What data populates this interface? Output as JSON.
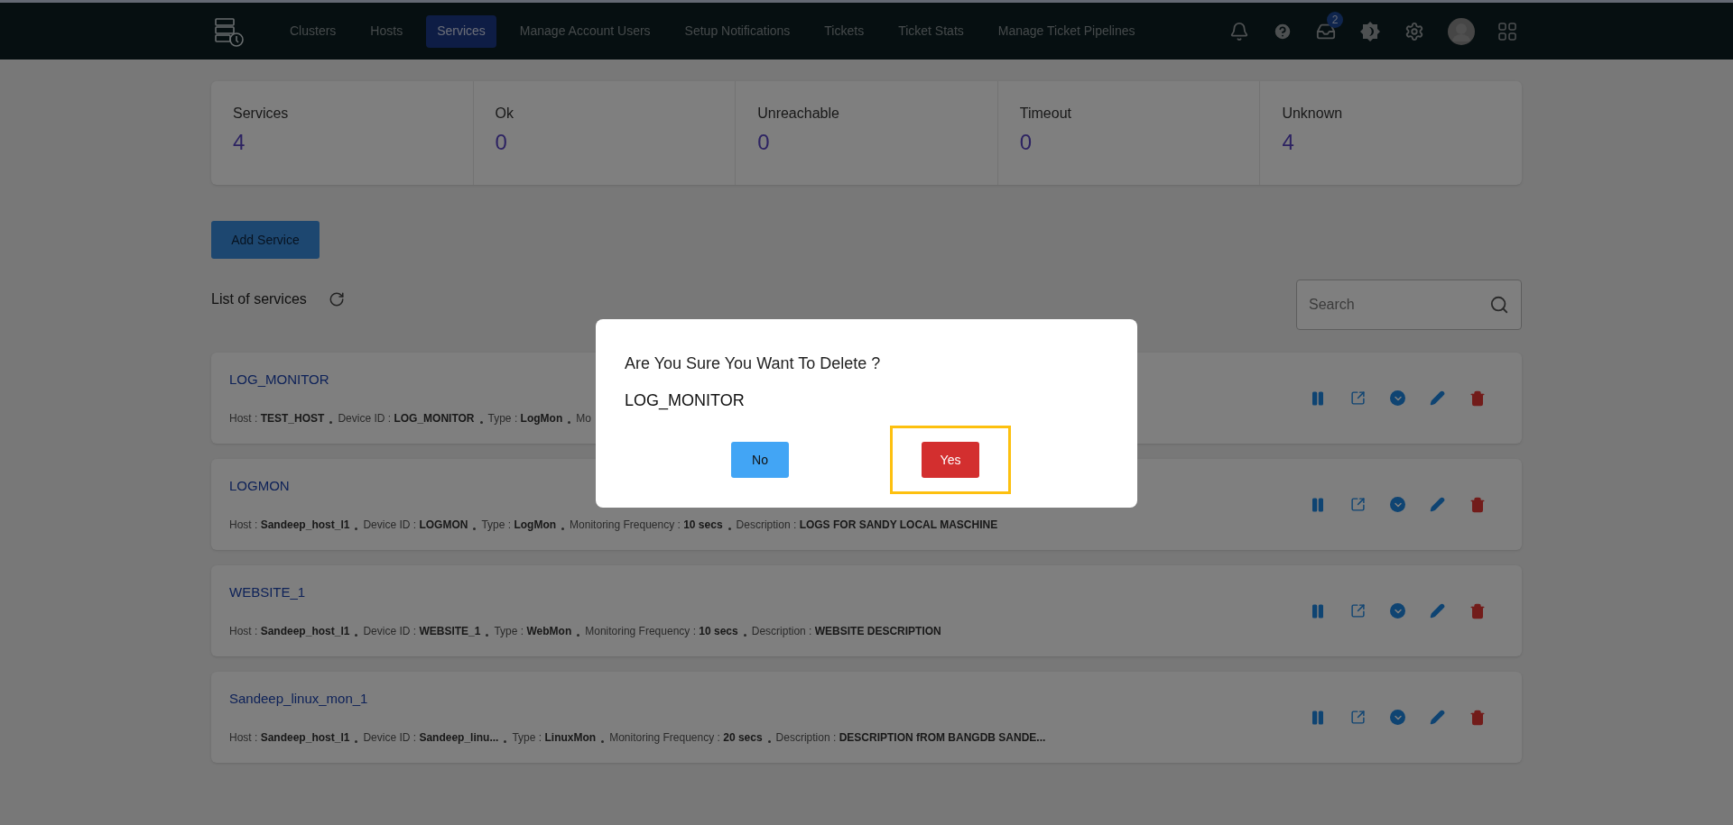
{
  "navbar": {
    "items": [
      {
        "label": "Clusters",
        "selected": false
      },
      {
        "label": "Hosts",
        "selected": false
      },
      {
        "label": "Services",
        "selected": true
      },
      {
        "label": "Manage Account Users",
        "selected": false
      },
      {
        "label": "Setup Notifications",
        "selected": false
      },
      {
        "label": "Tickets",
        "selected": false
      },
      {
        "label": "Ticket Stats",
        "selected": false
      },
      {
        "label": "Manage Ticket Pipelines",
        "selected": false
      }
    ],
    "inbox_badge": "2"
  },
  "stats": [
    {
      "label": "Services",
      "value": "4"
    },
    {
      "label": "Ok",
      "value": "0"
    },
    {
      "label": "Unreachable",
      "value": "0"
    },
    {
      "label": "Timeout",
      "value": "0"
    },
    {
      "label": "Unknown",
      "value": "4"
    }
  ],
  "add_button": "Add Service",
  "list_title": "List of services",
  "search": {
    "placeholder": "Search"
  },
  "services": [
    {
      "name": "LOG_MONITOR",
      "fields": [
        {
          "label": "Host :",
          "value": "TEST_HOST"
        },
        {
          "label": "Device ID :",
          "value": "LOG_MONITOR"
        },
        {
          "label": "Type :",
          "value": "LogMon"
        },
        {
          "label": "Mo"
        }
      ]
    },
    {
      "name": "LOGMON",
      "fields": [
        {
          "label": "Host :",
          "value": "Sandeep_host_l1"
        },
        {
          "label": "Device ID :",
          "value": "LOGMON"
        },
        {
          "label": "Type :",
          "value": "LogMon"
        },
        {
          "label": "Monitoring Frequency :",
          "value": "10 secs"
        },
        {
          "label": "Description :",
          "value": "LOGS FOR SANDY LOCAL MASCHINE"
        }
      ]
    },
    {
      "name": "WEBSITE_1",
      "fields": [
        {
          "label": "Host :",
          "value": "Sandeep_host_l1"
        },
        {
          "label": "Device ID :",
          "value": "WEBSITE_1"
        },
        {
          "label": "Type :",
          "value": "WebMon"
        },
        {
          "label": "Monitoring Frequency :",
          "value": "10 secs"
        },
        {
          "label": "Description :",
          "value": "WEBSITE DESCRIPTION"
        }
      ]
    },
    {
      "name": "Sandeep_linux_mon_1",
      "fields": [
        {
          "label": "Host :",
          "value": "Sandeep_host_l1"
        },
        {
          "label": "Device ID :",
          "value": "Sandeep_linu..."
        },
        {
          "label": "Type :",
          "value": "LinuxMon"
        },
        {
          "label": "Monitoring Frequency :",
          "value": "20 secs"
        },
        {
          "label": "Description :",
          "value": "DESCRIPTION fROM BANGDB SANDE..."
        }
      ]
    }
  ],
  "dialog": {
    "title": "Are You Sure You Want To Delete ?",
    "item": "LOG_MONITOR",
    "buttons": [
      {
        "label": "No",
        "kind": "cancel"
      },
      {
        "label": "Yes",
        "kind": "confirm",
        "highlighted": true
      }
    ]
  }
}
